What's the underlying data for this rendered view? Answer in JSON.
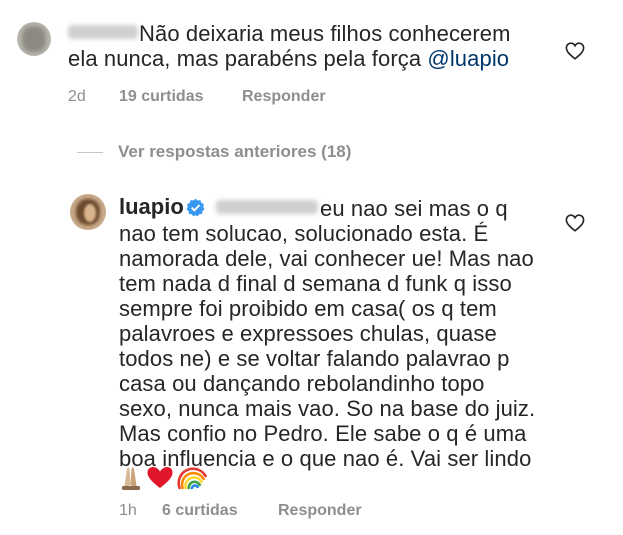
{
  "comment1": {
    "username_redacted": true,
    "text_line1": "Não deixaria meus filhos conhecerem",
    "text_line2_prefix": "ela nunca, mas parabéns pela força ",
    "mention": "@luapio",
    "time": "2d",
    "likes": "19 curtidas",
    "reply": "Responder",
    "like_icon": "heart-outline-icon"
  },
  "view_previous": "Ver respostas anteriores (18)",
  "comment2": {
    "username": "luapio",
    "verified_icon": "verified-badge-icon",
    "verified_color": "#3897f0",
    "mention_redacted": true,
    "lines": [
      "eu nao sei mas o q",
      "nao tem solucao, solucionado esta. É",
      "namorada dele, vai conhecer ue! Mas nao",
      "tem nada d final d semana d funk q isso",
      "sempre foi proibido em casa( os q tem",
      "palavroes e expressoes chulas, quase",
      "todos ne) e se voltar falando palavrao p",
      "casa ou dançando rebolandinho topo",
      "sexo, nunca mais vao. So na base do juiz.",
      "Mas confio no Pedro. Ele sabe o q é uma",
      "boa influencia e o que nao é. Vai ser lindo"
    ],
    "emojis": [
      "folded-hands-emoji",
      "red-heart-emoji",
      "rainbow-emoji"
    ],
    "time": "1h",
    "likes": "6 curtidas",
    "reply": "Responder",
    "like_icon": "heart-outline-icon"
  }
}
